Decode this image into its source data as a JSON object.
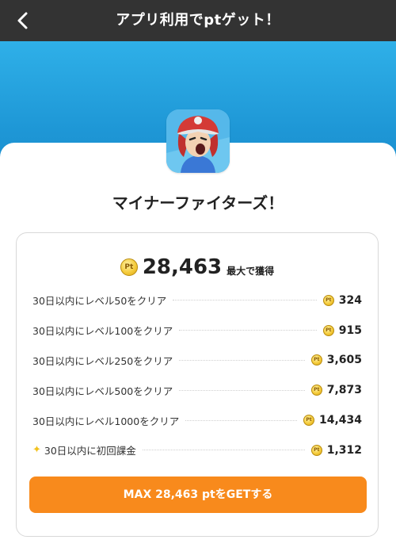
{
  "header": {
    "title": "アプリ利用でptゲット！",
    "back_icon": "chevron-left-icon"
  },
  "colors": {
    "header_bg": "#333333",
    "hero_blue": "#1e97d6",
    "cta_orange": "#f88a1c",
    "coin_gold": "#f5cc3c"
  },
  "app": {
    "icon": "app-icon-character",
    "name": "マイナーファイターズ！"
  },
  "reward": {
    "coin_label": "Pt",
    "total": "28,463",
    "total_suffix": "最大で獲得",
    "rows": [
      {
        "label": "30日以内にレベル50をクリア",
        "points": "324"
      },
      {
        "label": "30日以内にレベル100をクリア",
        "points": "915"
      },
      {
        "label": "30日以内にレベル250をクリア",
        "points": "3,605"
      },
      {
        "label": "30日以内にレベル500をクリア",
        "points": "7,873"
      },
      {
        "label": "30日以内にレベル1000をクリア",
        "points": "14,434"
      },
      {
        "label": "30日以内に初回課金",
        "points": "1,312",
        "icon": "sparkle-icon"
      }
    ],
    "cta_label": "MAX 28,463 ptをGETする"
  }
}
